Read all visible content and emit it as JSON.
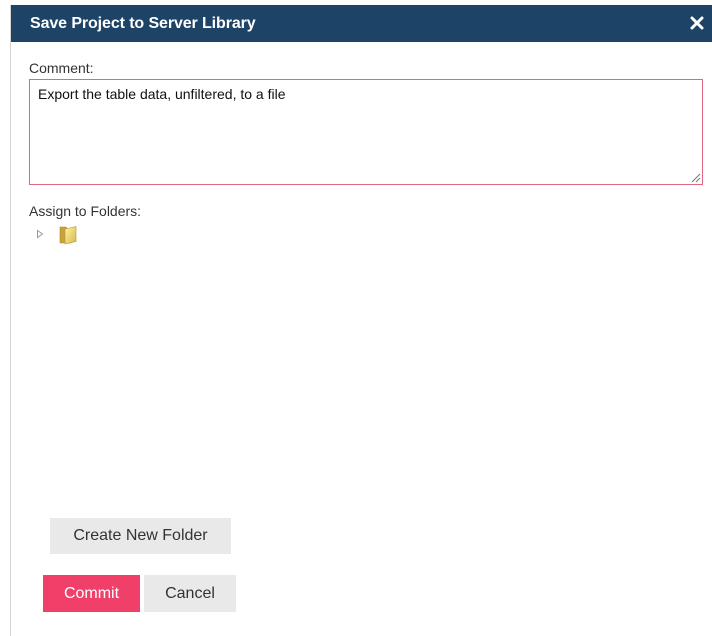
{
  "dialog": {
    "title": "Save Project to Server Library",
    "close_icon": "close-icon"
  },
  "comment": {
    "label": "Comment:",
    "value": "Export the table data, unfiltered, to a file"
  },
  "folders": {
    "label": "Assign to Folders:",
    "tree": [
      {
        "icon": "folder-icon",
        "expander_icon": "triangle-right-icon",
        "expanded": false
      }
    ]
  },
  "buttons": {
    "create_new_folder": "Create New Folder",
    "commit": "Commit",
    "cancel": "Cancel"
  },
  "colors": {
    "titlebar": "#1d4466",
    "commit": "#f0406a",
    "input_border": "#e0677f",
    "secondary_button": "#e9e9e9"
  }
}
